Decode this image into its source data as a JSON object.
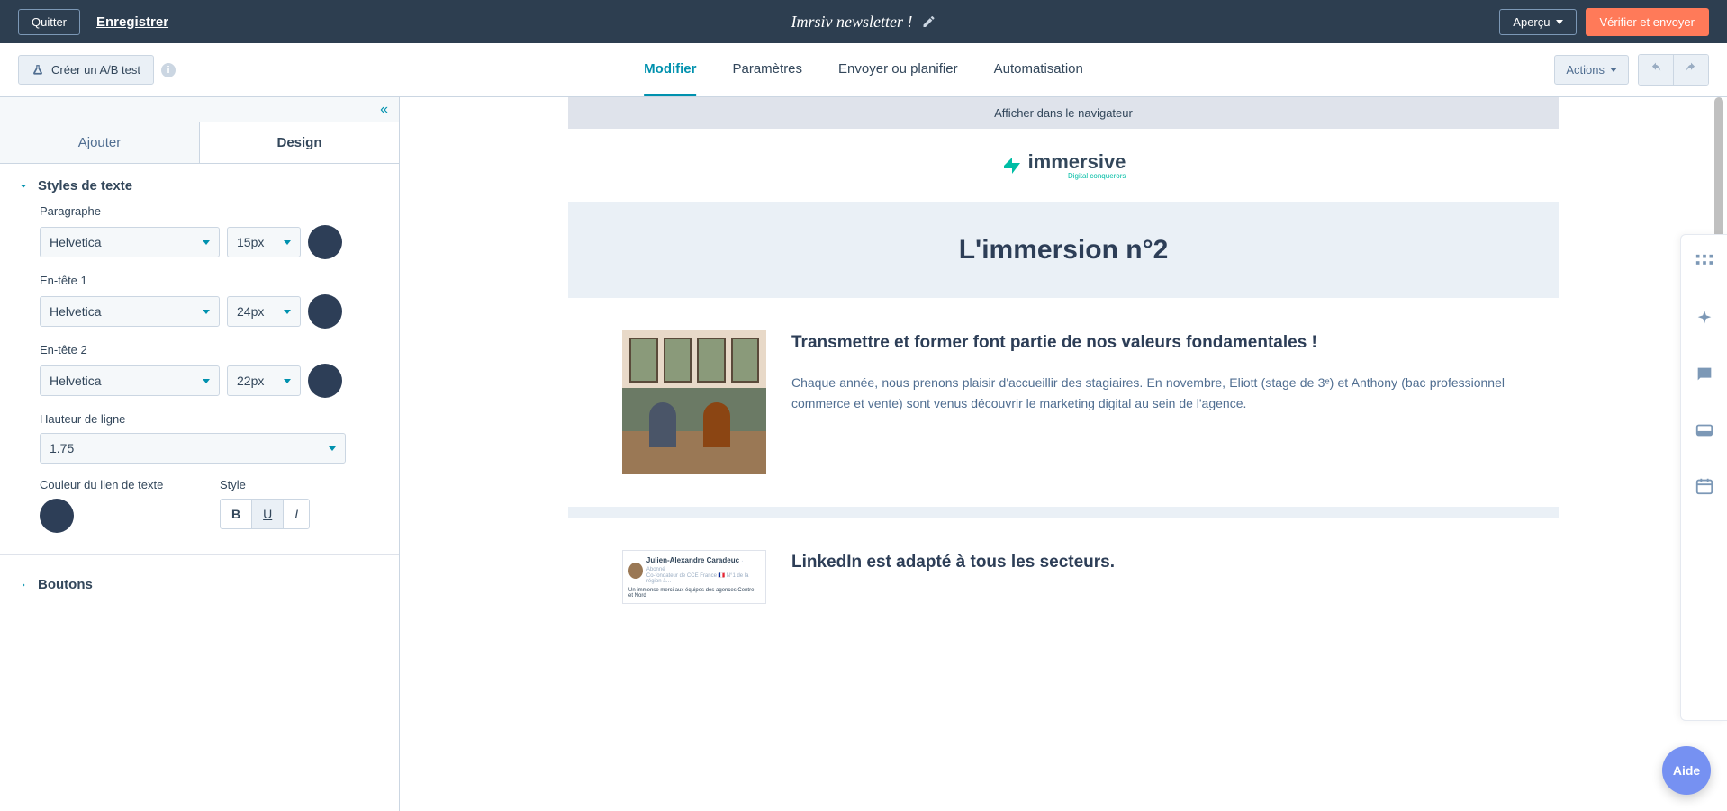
{
  "topbar": {
    "quit": "Quitter",
    "save": "Enregistrer",
    "title": "Imrsiv newsletter !",
    "preview": "Aperçu",
    "verify_send": "Vérifier et envoyer"
  },
  "secondnav": {
    "abtest": "Créer un A/B test",
    "tabs": {
      "modifier": "Modifier",
      "parametres": "Paramètres",
      "envoyer": "Envoyer ou planifier",
      "automatisation": "Automatisation"
    },
    "actions": "Actions"
  },
  "sidebar": {
    "tabs": {
      "ajouter": "Ajouter",
      "design": "Design"
    },
    "text_styles": {
      "header": "Styles de texte",
      "paragraphe": {
        "label": "Paragraphe",
        "font": "Helvetica",
        "size": "15px",
        "color": "#2d3e57"
      },
      "entete1": {
        "label": "En-tête 1",
        "font": "Helvetica",
        "size": "24px",
        "color": "#2d3e57"
      },
      "entete2": {
        "label": "En-tête 2",
        "font": "Helvetica",
        "size": "22px",
        "color": "#2d3e57"
      },
      "lineheight": {
        "label": "Hauteur de ligne",
        "value": "1.75"
      },
      "linkcolor": {
        "label": "Couleur du lien de texte",
        "color": "#2d3e57"
      },
      "style": {
        "label": "Style",
        "bold": "B",
        "underline": "U",
        "italic": "I"
      }
    },
    "boutons": {
      "header": "Boutons"
    }
  },
  "email": {
    "browser_link": "Afficher dans le navigateur",
    "logo": {
      "text": "immersive",
      "sub": "Digital conquerors"
    },
    "hero": "L'immersion n°2",
    "article1": {
      "heading": "Transmettre et former font partie de nos valeurs fondamentales !",
      "body": "Chaque année, nous prenons plaisir d'accueillir des stagiaires. En novembre, Eliott (stage de 3ᵉ) et Anthony (bac professionnel commerce et vente) sont venus découvrir le marketing digital au sein de l'agence."
    },
    "article2": {
      "heading": "LinkedIn est adapté à tous les secteurs.",
      "li_name": "Julien-Alexandre Caradeuc",
      "li_tag": "· Abonné",
      "li_sub": "Co-fondateur de CCE France 🇫🇷 N°1 de la région à…",
      "li_body": "Un immense merci aux équipes des agences Centre et Nord"
    }
  },
  "help": "Aide"
}
